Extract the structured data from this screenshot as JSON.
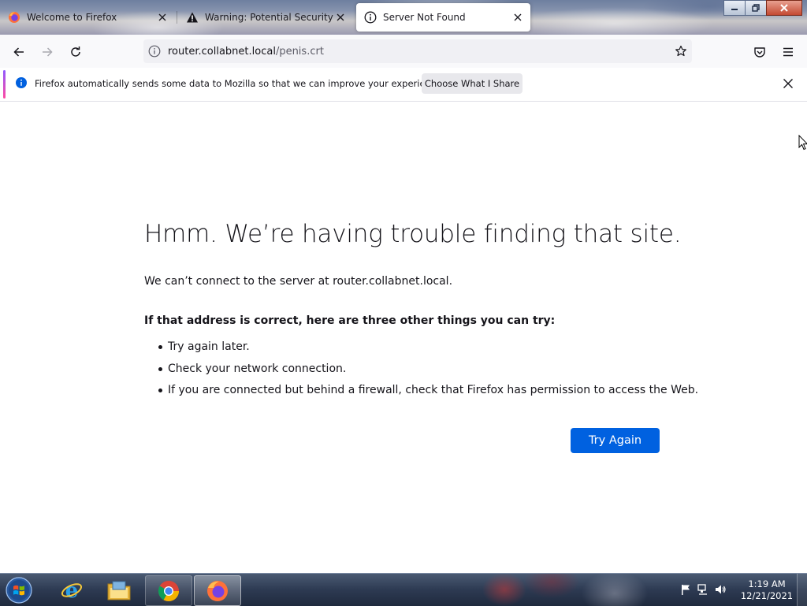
{
  "tabs": [
    {
      "title": "Welcome to Firefox",
      "icon": "firefox-icon"
    },
    {
      "title": "Warning: Potential Security Risk Ahead",
      "icon": "warning-icon"
    },
    {
      "title": "Server Not Found",
      "icon": "info-icon",
      "active": true
    }
  ],
  "navbar": {
    "url_host": "router.collabnet.local",
    "url_path": "/penis.crt"
  },
  "notification": {
    "message": "Firefox automatically sends some data to Mozilla so that we can improve your experience.",
    "button_label": "Choose What I Share"
  },
  "error_page": {
    "heading": "Hmm. We’re having trouble finding that site.",
    "description": "We can’t connect to the server at router.collabnet.local.",
    "subheading": "If that address is correct, here are three other things you can try:",
    "tips": [
      "Try again later.",
      "Check your network connection.",
      "If you are connected but behind a firewall, check that Firefox has permission to access the Web."
    ],
    "button_label": "Try Again"
  },
  "taskbar": {
    "apps": [
      "internet-explorer-icon",
      "file-explorer-icon",
      "chrome-icon",
      "firefox-icon"
    ],
    "clock_time": "1:19 AM",
    "clock_date": "12/21/2021"
  },
  "colors": {
    "accent_blue": "#0061e0",
    "tab_active_bg": "#ffffff",
    "navbar_bg": "#f9f9fb"
  }
}
